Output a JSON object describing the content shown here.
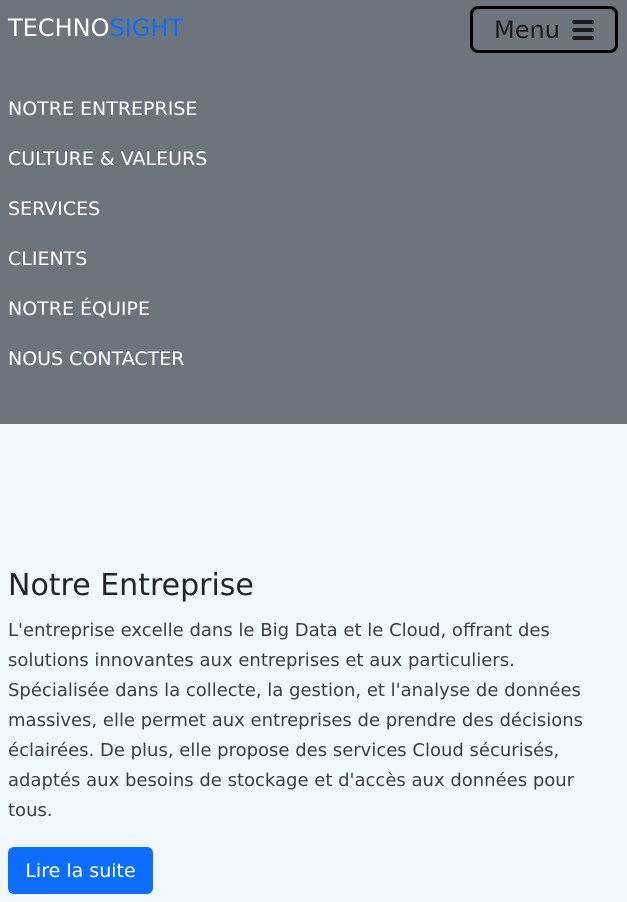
{
  "brand": {
    "part1": "TECHNO",
    "part2": "SIGHT",
    "color_part1": "#ffffff",
    "color_part2": "#0d6efd"
  },
  "menu_button": {
    "label": "Menu",
    "icon": "hamburger-icon"
  },
  "nav": {
    "items": [
      {
        "label": "NOTRE ENTREPRISE"
      },
      {
        "label": "CULTURE & VALEURS"
      },
      {
        "label": "SERVICES"
      },
      {
        "label": "CLIENTS"
      },
      {
        "label": "NOTRE ÉQUIPE"
      },
      {
        "label": "NOUS CONTACTER"
      }
    ],
    "background_color": "#6c757d"
  },
  "section": {
    "title": "Notre Entreprise",
    "body": "L'entreprise excelle dans le Big Data et le Cloud, offrant des solutions innovantes aux entreprises et aux particuliers. Spécialisée dans la collecte, la gestion, et l'analyse de données massives, elle permet aux entreprises de prendre des décisions éclairées. De plus, elle propose des services Cloud sécurisés, adaptés aux besoins de stockage et d'accès aux données pour tous.",
    "button_label": "Lire la suite",
    "button_color": "#0d6efd",
    "background_color": "#f0f8ff"
  }
}
